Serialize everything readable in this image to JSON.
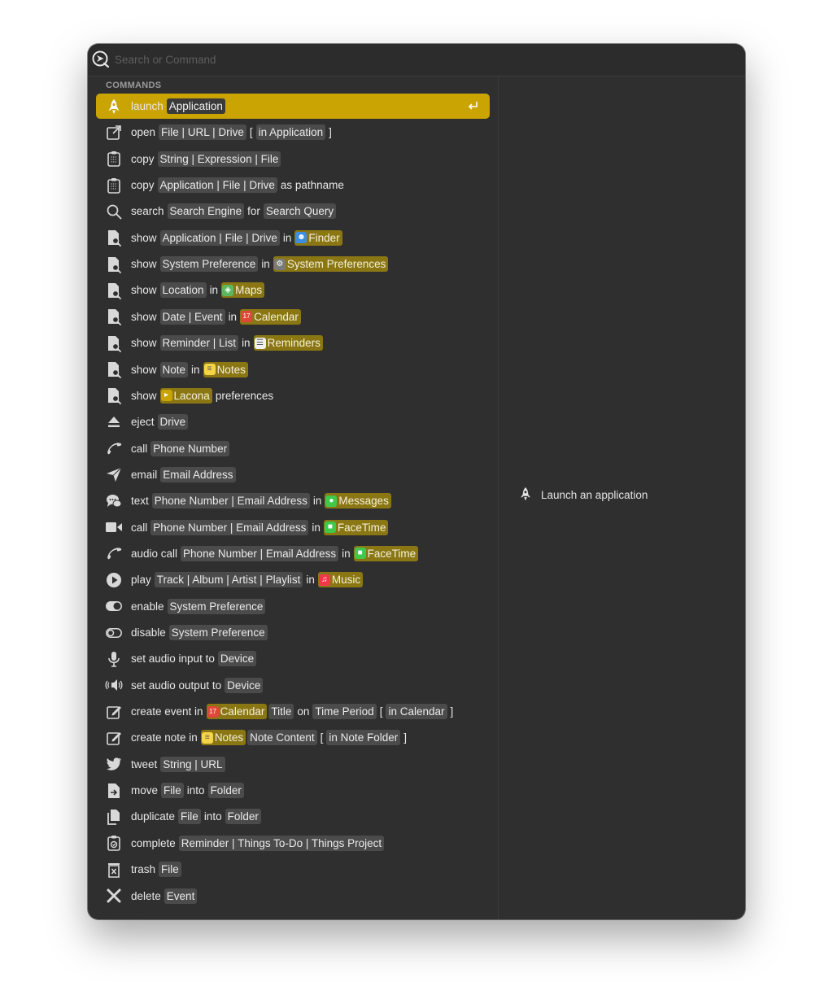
{
  "search": {
    "placeholder": "Search or Command",
    "value": ""
  },
  "section_title": "COMMANDS",
  "detail": {
    "icon": "rocket-icon",
    "text": "Launch an application"
  },
  "colors": {
    "accent": "#c9a402",
    "window_bg": "#2f2f2f",
    "placeholder_chip": "#4b4b4b",
    "app_chip": "#8a7714"
  },
  "commands": [
    {
      "icon": "rocket-icon",
      "selected": true,
      "parts": [
        {
          "t": "w",
          "v": "launch"
        },
        {
          "t": "p",
          "v": "Application"
        }
      ]
    },
    {
      "icon": "open-external-icon",
      "parts": [
        {
          "t": "w",
          "v": "open"
        },
        {
          "t": "p",
          "v": "File | URL | Drive"
        },
        {
          "t": "w",
          "v": "["
        },
        {
          "t": "p",
          "v": "in Application"
        },
        {
          "t": "w",
          "v": "]"
        }
      ]
    },
    {
      "icon": "clipboard-icon",
      "parts": [
        {
          "t": "w",
          "v": "copy"
        },
        {
          "t": "p",
          "v": "String | Expression | File"
        }
      ]
    },
    {
      "icon": "clipboard-icon",
      "parts": [
        {
          "t": "w",
          "v": "copy"
        },
        {
          "t": "p",
          "v": "Application | File | Drive"
        },
        {
          "t": "w",
          "v": "as pathname"
        }
      ]
    },
    {
      "icon": "magnifier-icon",
      "parts": [
        {
          "t": "w",
          "v": "search"
        },
        {
          "t": "p",
          "v": "Search Engine"
        },
        {
          "t": "w",
          "v": "for"
        },
        {
          "t": "p",
          "v": "Search Query"
        }
      ]
    },
    {
      "icon": "document-search-icon",
      "parts": [
        {
          "t": "w",
          "v": "show"
        },
        {
          "t": "p",
          "v": "Application | File | Drive"
        },
        {
          "t": "w",
          "v": "in"
        },
        {
          "t": "a",
          "v": "Finder",
          "icon": "finder-icon",
          "color": "#3d8ee0"
        }
      ]
    },
    {
      "icon": "document-search-icon",
      "parts": [
        {
          "t": "w",
          "v": "show"
        },
        {
          "t": "p",
          "v": "System Preference"
        },
        {
          "t": "w",
          "v": "in"
        },
        {
          "t": "a",
          "v": "System Preferences",
          "icon": "system-preferences-icon",
          "color": "#7a7a7a"
        }
      ]
    },
    {
      "icon": "document-search-icon",
      "parts": [
        {
          "t": "w",
          "v": "show"
        },
        {
          "t": "p",
          "v": "Location"
        },
        {
          "t": "w",
          "v": "in"
        },
        {
          "t": "a",
          "v": "Maps",
          "icon": "maps-icon",
          "color": "#5cb85c"
        }
      ]
    },
    {
      "icon": "document-search-icon",
      "parts": [
        {
          "t": "w",
          "v": "show"
        },
        {
          "t": "p",
          "v": "Date | Event"
        },
        {
          "t": "w",
          "v": "in"
        },
        {
          "t": "a",
          "v": "Calendar",
          "icon": "calendar-icon",
          "color": "#e0463a"
        }
      ]
    },
    {
      "icon": "document-search-icon",
      "parts": [
        {
          "t": "w",
          "v": "show"
        },
        {
          "t": "p",
          "v": "Reminder | List"
        },
        {
          "t": "w",
          "v": "in"
        },
        {
          "t": "a",
          "v": "Reminders",
          "icon": "reminders-icon",
          "color": "#f0f0f0"
        }
      ]
    },
    {
      "icon": "document-search-icon",
      "parts": [
        {
          "t": "w",
          "v": "show"
        },
        {
          "t": "p",
          "v": "Note"
        },
        {
          "t": "w",
          "v": "in"
        },
        {
          "t": "a",
          "v": "Notes",
          "icon": "notes-icon",
          "color": "#f5d547"
        }
      ]
    },
    {
      "icon": "document-search-icon",
      "parts": [
        {
          "t": "w",
          "v": "show"
        },
        {
          "t": "a",
          "v": "Lacona",
          "icon": "lacona-icon",
          "color": "#c9a402"
        },
        {
          "t": "w",
          "v": "preferences"
        }
      ]
    },
    {
      "icon": "eject-icon",
      "parts": [
        {
          "t": "w",
          "v": "eject"
        },
        {
          "t": "p",
          "v": "Drive"
        }
      ]
    },
    {
      "icon": "phone-icon",
      "parts": [
        {
          "t": "w",
          "v": "call"
        },
        {
          "t": "p",
          "v": "Phone Number"
        }
      ]
    },
    {
      "icon": "paper-plane-icon",
      "parts": [
        {
          "t": "w",
          "v": "email"
        },
        {
          "t": "p",
          "v": "Email Address"
        }
      ]
    },
    {
      "icon": "chat-bubbles-icon",
      "parts": [
        {
          "t": "w",
          "v": "text"
        },
        {
          "t": "p",
          "v": "Phone Number | Email Address"
        },
        {
          "t": "w",
          "v": "in"
        },
        {
          "t": "a",
          "v": "Messages",
          "icon": "messages-icon",
          "color": "#3fc84a"
        }
      ]
    },
    {
      "icon": "video-camera-icon",
      "parts": [
        {
          "t": "w",
          "v": "call"
        },
        {
          "t": "p",
          "v": "Phone Number | Email Address"
        },
        {
          "t": "w",
          "v": "in"
        },
        {
          "t": "a",
          "v": "FaceTime",
          "icon": "facetime-icon",
          "color": "#3fc84a"
        }
      ]
    },
    {
      "icon": "phone-icon",
      "parts": [
        {
          "t": "w",
          "v": "audio call"
        },
        {
          "t": "p",
          "v": "Phone Number | Email Address"
        },
        {
          "t": "w",
          "v": "in"
        },
        {
          "t": "a",
          "v": "FaceTime",
          "icon": "facetime-icon",
          "color": "#3fc84a"
        }
      ]
    },
    {
      "icon": "play-circle-icon",
      "parts": [
        {
          "t": "w",
          "v": "play"
        },
        {
          "t": "p",
          "v": "Track | Album | Artist | Playlist"
        },
        {
          "t": "w",
          "v": "in"
        },
        {
          "t": "a",
          "v": "Music",
          "icon": "music-icon",
          "color": "#f0384a"
        }
      ]
    },
    {
      "icon": "toggle-on-icon",
      "parts": [
        {
          "t": "w",
          "v": "enable"
        },
        {
          "t": "p",
          "v": "System Preference"
        }
      ]
    },
    {
      "icon": "toggle-off-icon",
      "parts": [
        {
          "t": "w",
          "v": "disable"
        },
        {
          "t": "p",
          "v": "System Preference"
        }
      ]
    },
    {
      "icon": "microphone-icon",
      "parts": [
        {
          "t": "w",
          "v": "set audio input to"
        },
        {
          "t": "p",
          "v": "Device"
        }
      ]
    },
    {
      "icon": "speaker-icon",
      "parts": [
        {
          "t": "w",
          "v": "set audio output to"
        },
        {
          "t": "p",
          "v": "Device"
        }
      ]
    },
    {
      "icon": "compose-icon",
      "parts": [
        {
          "t": "w",
          "v": "create event in"
        },
        {
          "t": "a",
          "v": "Calendar",
          "icon": "calendar-icon",
          "color": "#e0463a"
        },
        {
          "t": "p",
          "v": "Title"
        },
        {
          "t": "w",
          "v": "on"
        },
        {
          "t": "p",
          "v": "Time Period"
        },
        {
          "t": "w",
          "v": "["
        },
        {
          "t": "p",
          "v": "in Calendar"
        },
        {
          "t": "w",
          "v": "]"
        }
      ]
    },
    {
      "icon": "compose-icon",
      "parts": [
        {
          "t": "w",
          "v": "create note in"
        },
        {
          "t": "a",
          "v": "Notes",
          "icon": "notes-icon",
          "color": "#f5d547"
        },
        {
          "t": "p",
          "v": "Note Content"
        },
        {
          "t": "w",
          "v": "["
        },
        {
          "t": "p",
          "v": "in Note Folder"
        },
        {
          "t": "w",
          "v": "]"
        }
      ]
    },
    {
      "icon": "twitter-bird-icon",
      "parts": [
        {
          "t": "w",
          "v": "tweet"
        },
        {
          "t": "p",
          "v": "String | URL"
        }
      ]
    },
    {
      "icon": "move-file-icon",
      "parts": [
        {
          "t": "w",
          "v": "move"
        },
        {
          "t": "p",
          "v": "File"
        },
        {
          "t": "w",
          "v": "into"
        },
        {
          "t": "p",
          "v": "Folder"
        }
      ]
    },
    {
      "icon": "duplicate-icon",
      "parts": [
        {
          "t": "w",
          "v": "duplicate"
        },
        {
          "t": "p",
          "v": "File"
        },
        {
          "t": "w",
          "v": "into"
        },
        {
          "t": "p",
          "v": "Folder"
        }
      ]
    },
    {
      "icon": "checklist-icon",
      "parts": [
        {
          "t": "w",
          "v": "complete"
        },
        {
          "t": "p",
          "v": "Reminder | Things To-Do | Things Project"
        }
      ]
    },
    {
      "icon": "trash-icon",
      "parts": [
        {
          "t": "w",
          "v": "trash"
        },
        {
          "t": "p",
          "v": "File"
        }
      ]
    },
    {
      "icon": "x-mark-icon",
      "parts": [
        {
          "t": "w",
          "v": "delete"
        },
        {
          "t": "p",
          "v": "Event"
        }
      ]
    }
  ]
}
